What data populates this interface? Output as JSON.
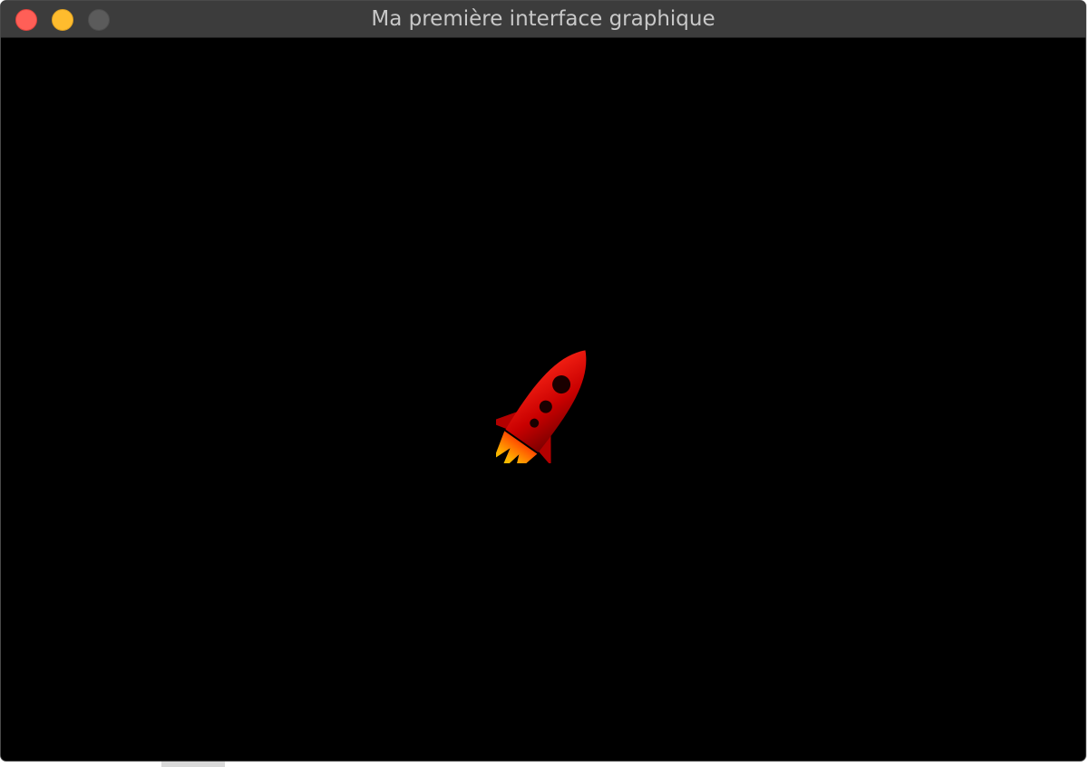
{
  "window": {
    "title": "Ma première interface graphique",
    "controls": {
      "close": "close-button",
      "minimize": "minimize-button",
      "zoom": "zoom-button"
    }
  },
  "canvas": {
    "background": "#000000",
    "sprite": "rocket-icon"
  },
  "colors": {
    "close": "#ff5f57",
    "minimize": "#febc2e",
    "zoom": "#5b5b5b",
    "rocket_body": "#d10000",
    "flame": "#ff9a00"
  }
}
